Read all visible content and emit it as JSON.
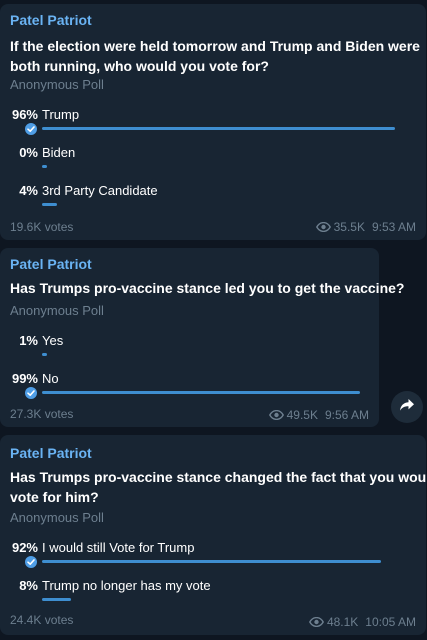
{
  "colors": {
    "background": "#0e1621",
    "bubble": "#182533",
    "sender": "#6ab3f3",
    "bar": "#3e8ed0",
    "muted": "#6d7f8f"
  },
  "posts": [
    {
      "sender": "Patel Patriot",
      "question_lines": [
        "If the election were held tomorrow and Trump and Biden were",
        "both running, who would you vote for?"
      ],
      "poll_type": "Anonymous Poll",
      "options": [
        {
          "pct": "96%",
          "label": "Trump",
          "share": 0.96,
          "chosen": true
        },
        {
          "pct": "0%",
          "label": "Biden",
          "share": 0.0,
          "chosen": false
        },
        {
          "pct": "4%",
          "label": "3rd Party Candidate",
          "share": 0.04,
          "chosen": false
        }
      ],
      "votes": "19.6K votes",
      "views": "35.5K",
      "time": "9:53 AM"
    },
    {
      "sender": "Patel Patriot",
      "question_lines": [
        "Has Trumps pro-vaccine stance led you to get the vaccine?"
      ],
      "poll_type": "Anonymous Poll",
      "options": [
        {
          "pct": "1%",
          "label": "Yes",
          "share": 0.01,
          "chosen": false
        },
        {
          "pct": "99%",
          "label": "No",
          "share": 0.99,
          "chosen": true
        }
      ],
      "votes": "27.3K votes",
      "views": "49.5K",
      "time": "9:56 AM"
    },
    {
      "sender": "Patel Patriot",
      "question_lines": [
        "Has Trumps pro-vaccine stance changed the fact that you would",
        "vote for him?"
      ],
      "poll_type": "Anonymous Poll",
      "options": [
        {
          "pct": "92%",
          "label": "I would still Vote for Trump",
          "share": 0.92,
          "chosen": true
        },
        {
          "pct": "8%",
          "label": "Trump no longer has my vote",
          "share": 0.08,
          "chosen": false
        }
      ],
      "votes": "24.4K votes",
      "views": "48.1K",
      "time": "10:05 AM"
    }
  ],
  "share_icon": "share-arrow-icon"
}
